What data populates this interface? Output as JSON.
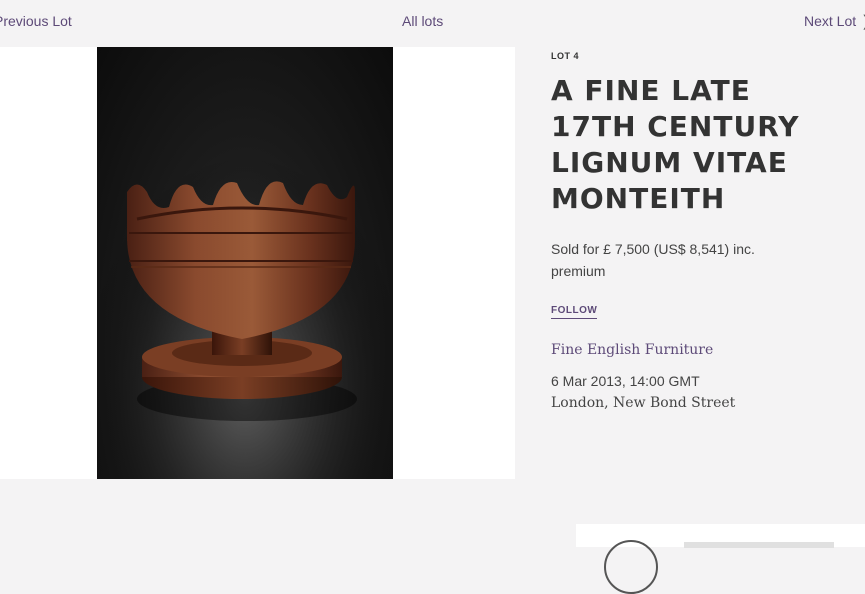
{
  "nav": {
    "previous_label": "Previous Lot",
    "all_label": "All lots",
    "next_label": "Next Lot",
    "next_icon": "chevron-right-icon"
  },
  "lot": {
    "number_label": "LOT 4",
    "title_lines": [
      "A FINE LATE",
      "17TH CENTURY",
      "LIGNUM VITAE",
      "MONTEITH"
    ],
    "sold_text": "Sold for £ 7,500 (US$ 8,541) inc. premium",
    "follow_label": "FOLLOW",
    "department": "Fine English Furniture",
    "sale_date": "6 Mar 2013, 14:00 GMT",
    "sale_location": "London, New Bond Street"
  },
  "colors": {
    "accent": "#5d4a78",
    "background": "#f4f3f4",
    "text": "#333333"
  }
}
